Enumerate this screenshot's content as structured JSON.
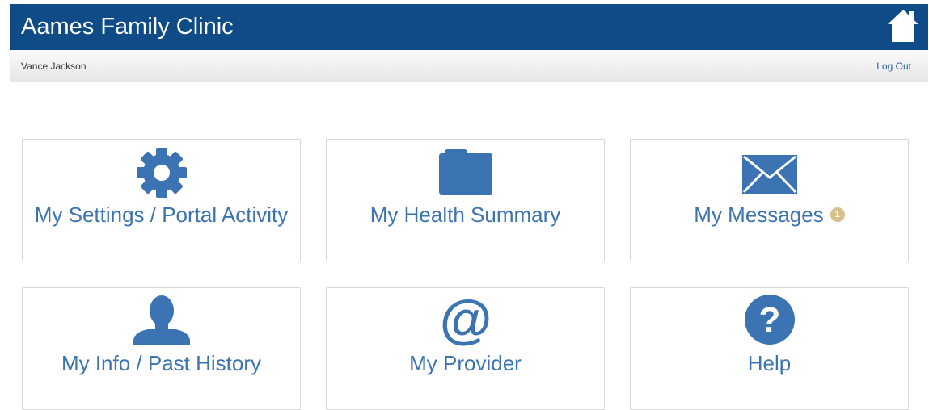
{
  "header": {
    "title": "Aames Family Clinic",
    "home_icon": "home-icon",
    "background": "#0f4c87"
  },
  "subbar": {
    "user_name": "Vance Jackson",
    "logout_label": "Log Out"
  },
  "tiles": [
    {
      "label": "My Settings / Portal Activity",
      "icon": "gear-icon"
    },
    {
      "label": "My Health Summary",
      "icon": "folder-icon"
    },
    {
      "label": "My Messages",
      "icon": "envelope-icon",
      "badge": "1"
    },
    {
      "label": "My Info / Past History",
      "icon": "person-icon"
    },
    {
      "label": "My Provider",
      "icon": "at-sign-icon"
    },
    {
      "label": "Help",
      "icon": "question-circle-icon"
    }
  ],
  "colors": {
    "accent": "#3b73b3",
    "badge": "#d6c08c"
  }
}
